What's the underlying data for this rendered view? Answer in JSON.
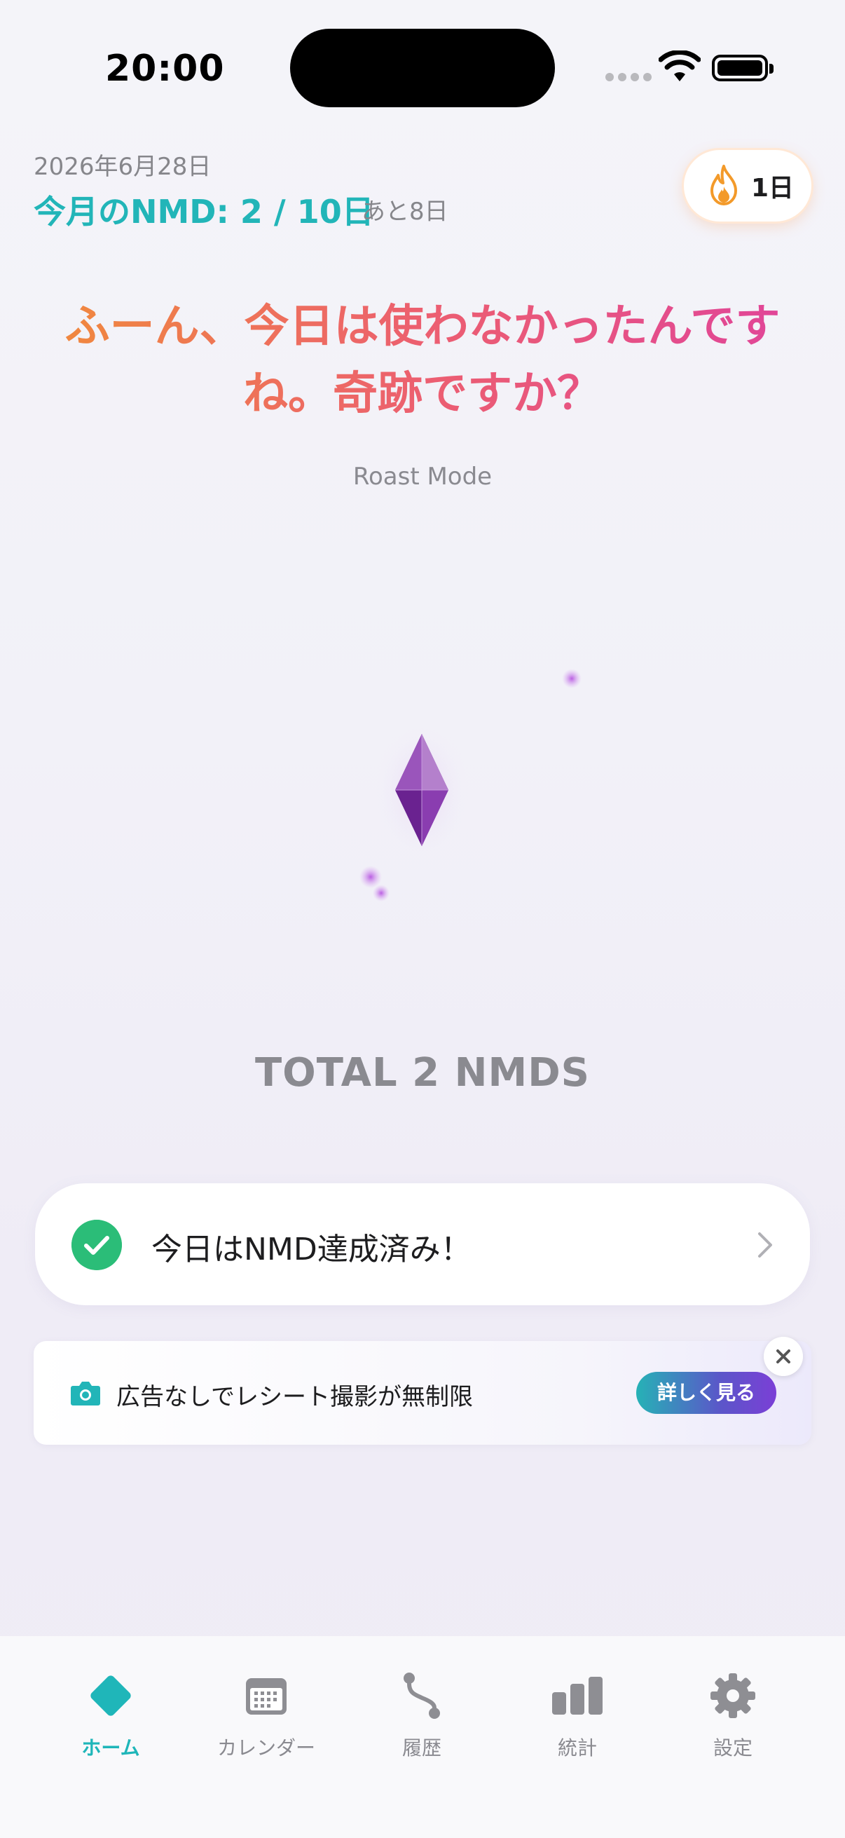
{
  "status_bar": {
    "time": "20:00"
  },
  "header": {
    "date": "2026年6月28日",
    "monthly_progress": "今月のNMD: 2 / 10日",
    "remaining": "あと8日",
    "streak": {
      "icon": "flame-icon",
      "label": "1日"
    }
  },
  "message": {
    "text": "ふーん、今日は使わなかったんですね。奇跡ですか？",
    "mode": "Roast Mode"
  },
  "crystal": {
    "icon": "crystal-gem-icon",
    "color": "#7b2fa0"
  },
  "total": {
    "label": "TOTAL 2 NMDS"
  },
  "achievement_card": {
    "icon": "check-circle-icon",
    "text": "今日はNMD達成済み！"
  },
  "ad_banner": {
    "icon": "camera-icon",
    "text": "広告なしでレシート撮影が無制限",
    "button_label": "詳しく見る"
  },
  "tab_bar": {
    "active": "ホーム",
    "items": [
      {
        "label": "ホーム",
        "icon": "diamond-icon"
      },
      {
        "label": "カレンダー",
        "icon": "calendar-icon"
      },
      {
        "label": "履歴",
        "icon": "route-icon"
      },
      {
        "label": "統計",
        "icon": "bar-chart-icon"
      },
      {
        "label": "設定",
        "icon": "gear-icon"
      }
    ]
  },
  "colors": {
    "accent": "#22b5b8",
    "success": "#2bbd78",
    "crystal": "#7b2fa0"
  }
}
